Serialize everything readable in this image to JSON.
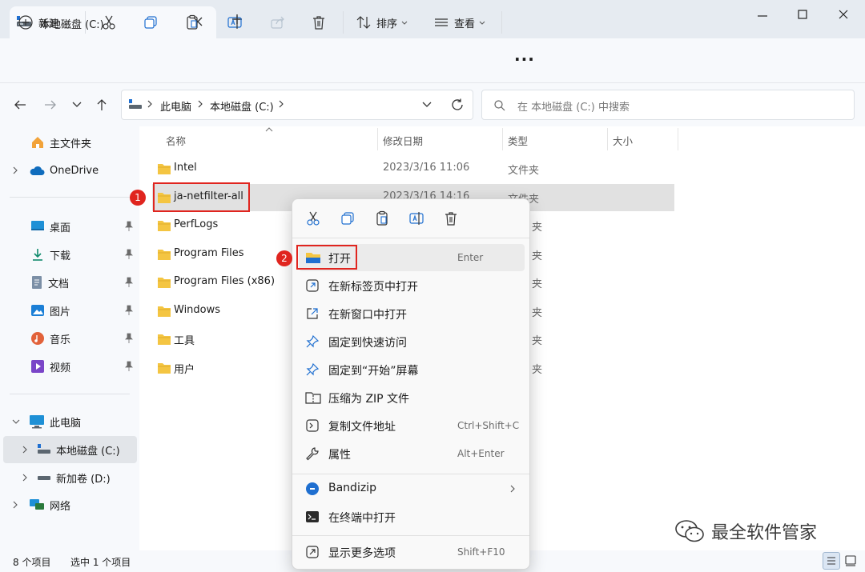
{
  "window": {
    "tab_title": "本地磁盘 (C:)",
    "new_tab": "+"
  },
  "toolbar": {
    "new_label": "新建",
    "sort_label": "排序",
    "view_label": "查看",
    "more": "···"
  },
  "address": {
    "breadcrumb": [
      "此电脑",
      "本地磁盘 (C:)"
    ],
    "search_placeholder": "在 本地磁盘 (C:) 中搜索"
  },
  "sidebar": {
    "home": "主文件夹",
    "onedrive": "OneDrive",
    "quick": [
      "桌面",
      "下载",
      "文档",
      "图片",
      "音乐",
      "视频"
    ],
    "this_pc": "此电脑",
    "drives": [
      "本地磁盘 (C:)",
      "新加卷 (D:)"
    ],
    "network": "网络"
  },
  "columns": {
    "name": "名称",
    "date": "修改日期",
    "type": "类型",
    "size": "大小"
  },
  "files": [
    {
      "name": "Intel",
      "date": "2023/3/16 11:06",
      "type": "文件夹"
    },
    {
      "name": "ja-netfilter-all",
      "date": "2023/3/16 14:16",
      "type": "文件夹"
    },
    {
      "name": "PerfLogs",
      "date": "",
      "type": "夹"
    },
    {
      "name": "Program Files",
      "date": "",
      "type": "夹"
    },
    {
      "name": "Program Files (x86)",
      "date": "",
      "type": "夹"
    },
    {
      "name": "Windows",
      "date": "",
      "type": "夹"
    },
    {
      "name": "工具",
      "date": "",
      "type": "夹"
    },
    {
      "name": "用户",
      "date": "",
      "type": "夹"
    }
  ],
  "status": {
    "count": "8 个项目",
    "selected": "选中 1 个项目"
  },
  "annotations": {
    "step1": "1",
    "step2": "2"
  },
  "context_menu": {
    "items": [
      {
        "label": "打开",
        "key": "Enter"
      },
      {
        "label": "在新标签页中打开",
        "key": ""
      },
      {
        "label": "在新窗口中打开",
        "key": ""
      },
      {
        "label": "固定到快速访问",
        "key": ""
      },
      {
        "label": "固定到“开始”屏幕",
        "key": ""
      },
      {
        "label": "压缩为 ZIP 文件",
        "key": ""
      },
      {
        "label": "复制文件地址",
        "key": "Ctrl+Shift+C"
      },
      {
        "label": "属性",
        "key": "Alt+Enter"
      },
      {
        "label": "Bandizip",
        "key": ""
      },
      {
        "label": "在终端中打开",
        "key": ""
      },
      {
        "label": "显示更多选项",
        "key": "Shift+F10"
      }
    ]
  },
  "watermark": "最全软件管家",
  "colors": {
    "accent": "#0067c0",
    "folder": "#f4c542",
    "highlight": "#e0251f",
    "selected_row": "#e1e1e1"
  }
}
